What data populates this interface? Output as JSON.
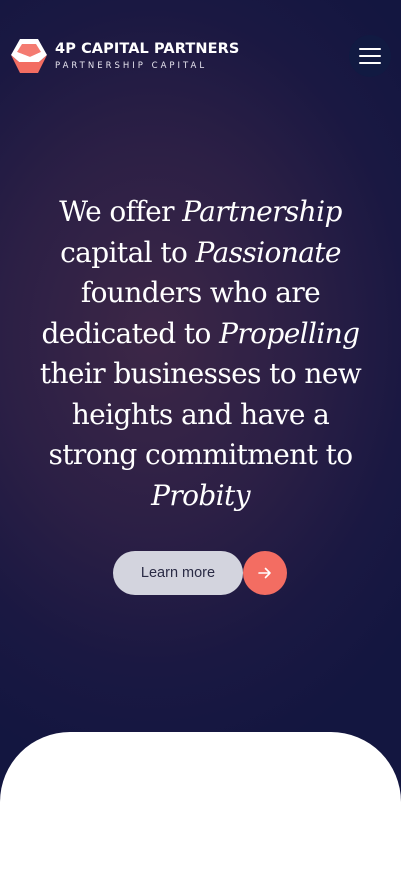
{
  "brand": {
    "name": "4P CAPITAL PARTNERS",
    "tagline": "PARTNERSHIP CAPITAL",
    "logo_icon": "hexagon-logo-icon",
    "colors": {
      "accent": "#f36d62",
      "dark": "#111a42"
    }
  },
  "header": {
    "menu_icon": "hamburger-menu-icon"
  },
  "hero": {
    "lines": [
      {
        "plain": "We offer ",
        "em": "Partnership"
      },
      {
        "plain": "capital to ",
        "em": "Passionate"
      },
      {
        "plain": "founders who are",
        "em": ""
      },
      {
        "plain": "dedicated to ",
        "em": "Propelling"
      },
      {
        "plain": "their businesses to new",
        "em": ""
      },
      {
        "plain": "heights and have a",
        "em": ""
      },
      {
        "plain": "strong commitment to",
        "em": ""
      },
      {
        "plain": "",
        "em": "Probity"
      }
    ]
  },
  "cta": {
    "learn_more_label": "Learn more",
    "arrow_icon": "arrow-right-icon"
  }
}
